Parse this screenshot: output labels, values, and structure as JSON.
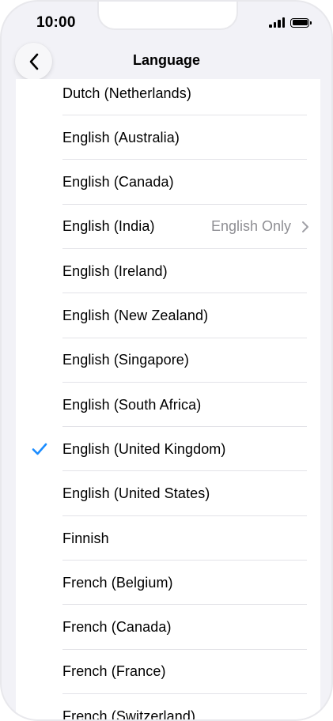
{
  "status_bar": {
    "time": "10:00"
  },
  "nav": {
    "title": "Language",
    "back_icon": "chevron-left-icon"
  },
  "languages": [
    {
      "label": "Dutch (Netherlands)",
      "detail": "",
      "selected": false,
      "has_chevron": false
    },
    {
      "label": "English (Australia)",
      "detail": "",
      "selected": false,
      "has_chevron": false
    },
    {
      "label": "English (Canada)",
      "detail": "",
      "selected": false,
      "has_chevron": false
    },
    {
      "label": "English (India)",
      "detail": "English Only",
      "selected": false,
      "has_chevron": true
    },
    {
      "label": "English (Ireland)",
      "detail": "",
      "selected": false,
      "has_chevron": false
    },
    {
      "label": "English (New Zealand)",
      "detail": "",
      "selected": false,
      "has_chevron": false
    },
    {
      "label": "English (Singapore)",
      "detail": "",
      "selected": false,
      "has_chevron": false
    },
    {
      "label": "English (South Africa)",
      "detail": "",
      "selected": false,
      "has_chevron": false
    },
    {
      "label": "English (United Kingdom)",
      "detail": "",
      "selected": true,
      "has_chevron": false
    },
    {
      "label": "English (United States)",
      "detail": "",
      "selected": false,
      "has_chevron": false
    },
    {
      "label": "Finnish",
      "detail": "",
      "selected": false,
      "has_chevron": false
    },
    {
      "label": "French (Belgium)",
      "detail": "",
      "selected": false,
      "has_chevron": false
    },
    {
      "label": "French (Canada)",
      "detail": "",
      "selected": false,
      "has_chevron": false
    },
    {
      "label": "French (France)",
      "detail": "",
      "selected": false,
      "has_chevron": false
    },
    {
      "label": "French (Switzerland)",
      "detail": "",
      "selected": false,
      "has_chevron": false
    }
  ],
  "colors": {
    "accent": "#1a8cff",
    "background": "#f2f2f7",
    "detail_text": "#8e8e93",
    "separator": "#e3e3e8"
  }
}
